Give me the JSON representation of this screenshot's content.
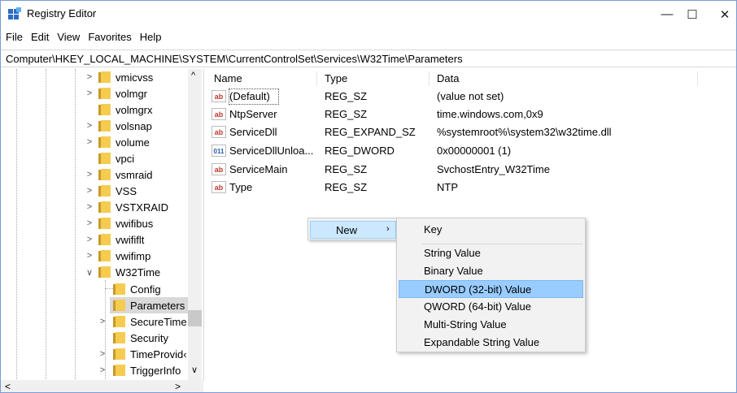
{
  "window": {
    "title": "Registry Editor",
    "minimize_glyph": "—",
    "maximize_glyph": "☐",
    "close_glyph": "✕"
  },
  "menu": [
    "File",
    "Edit",
    "View",
    "Favorites",
    "Help"
  ],
  "address": "Computer\\HKEY_LOCAL_MACHINE\\SYSTEM\\CurrentControlSet\\Services\\W32Time\\Parameters",
  "tree": {
    "items": [
      {
        "label": "vmicvss",
        "expander": ">"
      },
      {
        "label": "volmgr",
        "expander": ">"
      },
      {
        "label": "volmgrx",
        "expander": ""
      },
      {
        "label": "volsnap",
        "expander": ">"
      },
      {
        "label": "volume",
        "expander": ">"
      },
      {
        "label": "vpci",
        "expander": ""
      },
      {
        "label": "vsmraid",
        "expander": ">"
      },
      {
        "label": "VSS",
        "expander": ">"
      },
      {
        "label": "VSTXRAID",
        "expander": ">"
      },
      {
        "label": "vwifibus",
        "expander": ">"
      },
      {
        "label": "vwififlt",
        "expander": ">"
      },
      {
        "label": "vwifimp",
        "expander": ">"
      },
      {
        "label": "W32Time",
        "expander": "∨"
      }
    ],
    "children": [
      {
        "label": "Config",
        "expander": ""
      },
      {
        "label": "Parameters",
        "expander": "",
        "selected": true
      },
      {
        "label": "SecureTime",
        "expander": ">"
      },
      {
        "label": "Security",
        "expander": ""
      },
      {
        "label": "TimeProvid‹",
        "expander": ">"
      },
      {
        "label": "TriggerInfo",
        "expander": ">"
      }
    ],
    "scroll_up": "^",
    "scroll_down": "∨",
    "scroll_left": "<",
    "scroll_right": ">"
  },
  "columns": {
    "name": "Name",
    "type": "Type",
    "data": "Data"
  },
  "values": [
    {
      "icon": "ab",
      "kind": "string-value-icon",
      "name": "(Default)",
      "type": "REG_SZ",
      "data": "(value not set)"
    },
    {
      "icon": "ab",
      "kind": "string-value-icon",
      "name": "NtpServer",
      "type": "REG_SZ",
      "data": "time.windows.com,0x9"
    },
    {
      "icon": "ab",
      "kind": "string-value-icon",
      "name": "ServiceDll",
      "type": "REG_EXPAND_SZ",
      "data": "%systemroot%\\system32\\w32time.dll"
    },
    {
      "icon": "011",
      "kind": "binary-value-icon",
      "name": "ServiceDllUnloa...",
      "type": "REG_DWORD",
      "data": "0x00000001 (1)"
    },
    {
      "icon": "ab",
      "kind": "string-value-icon",
      "name": "ServiceMain",
      "type": "REG_SZ",
      "data": "SvchostEntry_W32Time"
    },
    {
      "icon": "ab",
      "kind": "string-value-icon",
      "name": "Type",
      "type": "REG_SZ",
      "data": "NTP"
    }
  ],
  "context_menu": {
    "new_label": "New",
    "new_arrow": "›",
    "submenu": [
      "Key",
      "String Value",
      "Binary Value",
      "DWORD (32-bit) Value",
      "QWORD (64-bit) Value",
      "Multi-String Value",
      "Expandable String Value"
    ],
    "highlighted": "DWORD (32-bit) Value"
  }
}
